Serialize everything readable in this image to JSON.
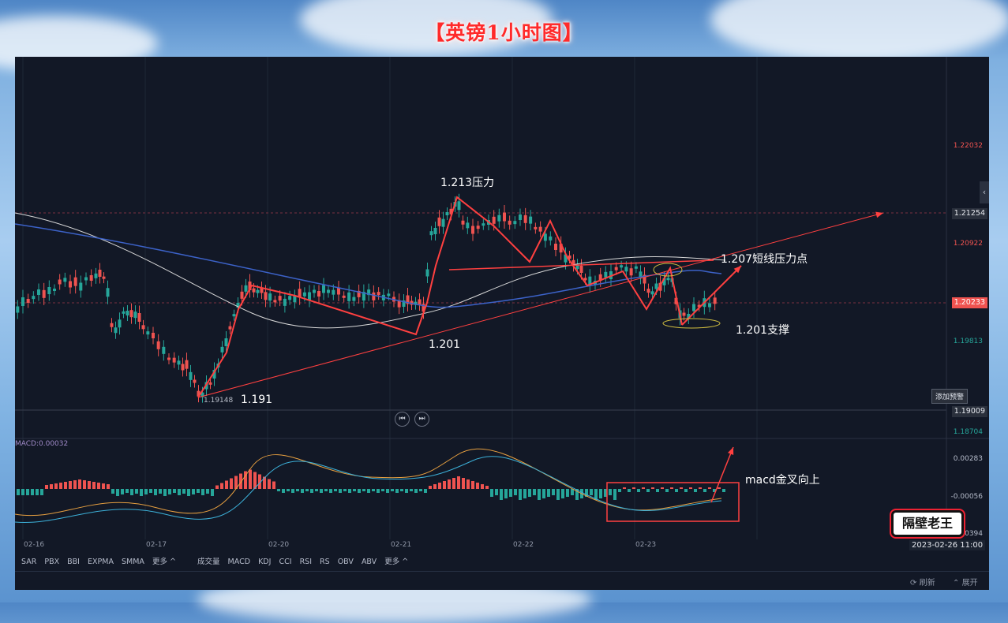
{
  "title": "【英镑1小时图】",
  "chart_data": {
    "type": "candlestick",
    "instrument": "英镑",
    "timeframe": "1小时",
    "dates": [
      "02-16",
      "02-17",
      "02-20",
      "02-21",
      "02-22",
      "02-23"
    ],
    "price_axis": {
      "ticks": [
        "1.22032",
        "1.20922",
        "1.19813",
        "1.18704"
      ],
      "ylim": [
        1.186,
        1.226
      ]
    },
    "price_tags": {
      "current": "1.20233",
      "level": "1.21254",
      "alert": "1.19009"
    },
    "annotations": {
      "resistance_top": "1.213压力",
      "short_resistance": "1.207短线压力点",
      "support": "1.201支撑",
      "low_mid": "1.201",
      "low_main": "1.191",
      "low_value": "1.19148",
      "macd_note": "macd金叉向上"
    },
    "macd": {
      "label": "MACD:0.00032",
      "ticks": [
        "0.00283",
        "-0.00056",
        "-0.00394"
      ]
    }
  },
  "indicators": {
    "main": [
      "SAR",
      "PBX",
      "BBI",
      "EXPMA",
      "SMMA",
      "更多 ^"
    ],
    "sub": [
      "成交量",
      "MACD",
      "KDJ",
      "CCI",
      "RSI",
      "RS",
      "OBV",
      "ABV",
      "更多 ^"
    ]
  },
  "controls": {
    "alert_button": "添加预警",
    "timestamp": "2023-02-26 11:00",
    "refresh": "刷新",
    "expand": "展开",
    "side_arrow": "‹",
    "nav_prev": "⏮",
    "nav_next": "⏭"
  },
  "watermark": "隔壁老王",
  "colors": {
    "up": "#26a69a",
    "down": "#ef5350",
    "annotation": "#ff4040",
    "background": "#121826"
  }
}
